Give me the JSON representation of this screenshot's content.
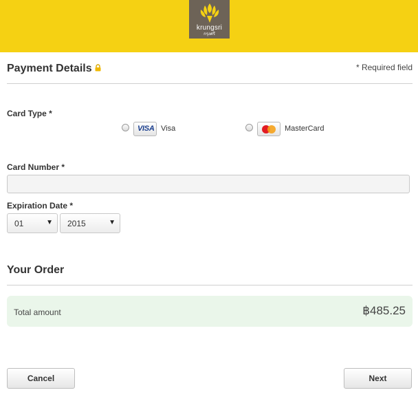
{
  "header": {
    "brand_name": "krungsri",
    "brand_subtitle": "กรุงศรี",
    "brand_color": "#f5d113",
    "logo_icon": "krungsri-logo-icon"
  },
  "payment": {
    "title": "Payment Details",
    "lock_icon": "lock-icon",
    "required_note": "* Required field",
    "card_type_label": "Card Type *",
    "card_options": [
      {
        "name": "Visa",
        "logo_text": "VISA",
        "selected": false
      },
      {
        "name": "MasterCard",
        "logo_text": "MasterCard",
        "selected": false
      }
    ],
    "card_number_label": "Card Number *",
    "card_number_value": "",
    "expiration_label": "Expiration Date *",
    "exp_month": "01",
    "exp_year": "2015"
  },
  "order": {
    "title": "Your Order",
    "total_label": "Total amount",
    "total_value": "฿485.25",
    "total_bg": "#eaf6ea"
  },
  "actions": {
    "cancel_label": "Cancel",
    "next_label": "Next"
  }
}
